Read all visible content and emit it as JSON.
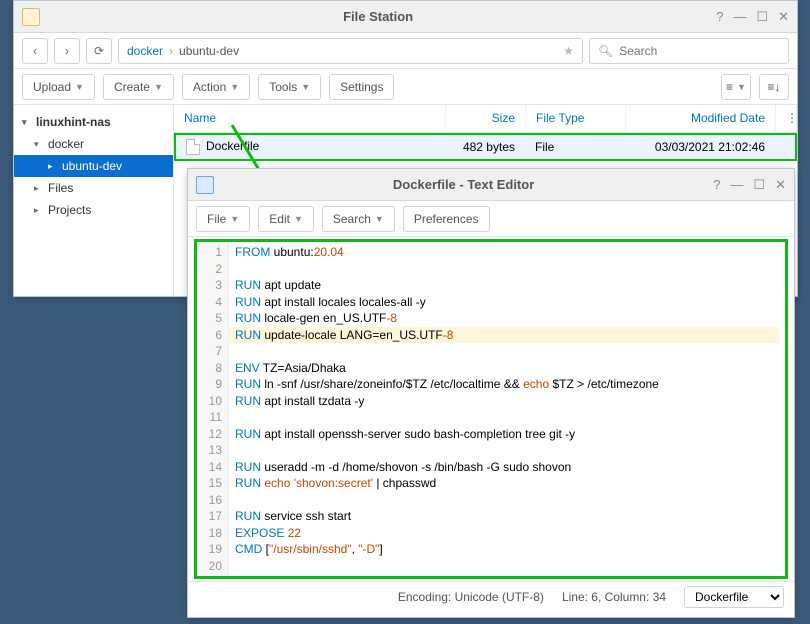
{
  "file_station": {
    "title": "File Station",
    "breadcrumb": [
      "docker",
      "ubuntu-dev"
    ],
    "search_placeholder": "Search",
    "toolbar": {
      "upload": "Upload",
      "create": "Create",
      "action": "Action",
      "tools": "Tools",
      "settings": "Settings"
    },
    "tree": {
      "root": "linuxhint-nas",
      "items": [
        {
          "label": "docker",
          "level": 1,
          "expanded": true
        },
        {
          "label": "ubuntu-dev",
          "level": 2,
          "selected": true
        },
        {
          "label": "Files",
          "level": 1
        },
        {
          "label": "Projects",
          "level": 1
        }
      ]
    },
    "columns": {
      "name": "Name",
      "size": "Size",
      "type": "File Type",
      "date": "Modified Date"
    },
    "rows": [
      {
        "name": "Dockerfile",
        "size": "482 bytes",
        "type": "File",
        "date": "03/03/2021 21:02:46"
      }
    ]
  },
  "text_editor": {
    "title": "Dockerfile - Text Editor",
    "toolbar": {
      "file": "File",
      "edit": "Edit",
      "search": "Search",
      "preferences": "Preferences"
    },
    "status": {
      "encoding": "Encoding: Unicode (UTF-8)",
      "cursor": "Line: 6, Column: 34",
      "lang": "Dockerfile"
    },
    "highlighted_line": 6,
    "lines": [
      {
        "n": 1,
        "tokens": [
          [
            "kw",
            "FROM"
          ],
          [
            "",
            " ubuntu:"
          ],
          [
            "num",
            "20.04"
          ]
        ]
      },
      {
        "n": 2,
        "tokens": []
      },
      {
        "n": 3,
        "tokens": [
          [
            "kw",
            "RUN"
          ],
          [
            "",
            " apt update"
          ]
        ]
      },
      {
        "n": 4,
        "tokens": [
          [
            "kw",
            "RUN"
          ],
          [
            "",
            " apt install locales locales-all -y"
          ]
        ]
      },
      {
        "n": 5,
        "tokens": [
          [
            "kw",
            "RUN"
          ],
          [
            "",
            " locale-gen en_US.UTF"
          ],
          [
            "num",
            "-8"
          ]
        ]
      },
      {
        "n": 6,
        "tokens": [
          [
            "kw",
            "RUN"
          ],
          [
            "",
            " update-locale LANG=en_US.UTF"
          ],
          [
            "num",
            "-8"
          ]
        ]
      },
      {
        "n": 7,
        "tokens": []
      },
      {
        "n": 8,
        "tokens": [
          [
            "kw",
            "ENV"
          ],
          [
            "",
            " TZ=Asia/Dhaka"
          ]
        ]
      },
      {
        "n": 9,
        "tokens": [
          [
            "kw",
            "RUN"
          ],
          [
            "",
            " ln -snf /usr/share/zoneinfo/$TZ /etc/localtime && "
          ],
          [
            "str",
            "echo"
          ],
          [
            "",
            " $TZ > /etc/timezone"
          ]
        ]
      },
      {
        "n": 10,
        "tokens": [
          [
            "kw",
            "RUN"
          ],
          [
            "",
            " apt install tzdata -y"
          ]
        ]
      },
      {
        "n": 11,
        "tokens": []
      },
      {
        "n": 12,
        "tokens": [
          [
            "kw",
            "RUN"
          ],
          [
            "",
            " apt install openssh-server sudo bash-completion tree git -y"
          ]
        ]
      },
      {
        "n": 13,
        "tokens": []
      },
      {
        "n": 14,
        "tokens": [
          [
            "kw",
            "RUN"
          ],
          [
            "",
            " useradd -m -d /home/shovon -s /bin/bash -G sudo shovon"
          ]
        ]
      },
      {
        "n": 15,
        "tokens": [
          [
            "kw",
            "RUN"
          ],
          [
            "",
            " "
          ],
          [
            "str",
            "echo"
          ],
          [
            "",
            " "
          ],
          [
            "str2",
            "'shovon:secret'"
          ],
          [
            "",
            " | chpasswd"
          ]
        ]
      },
      {
        "n": 16,
        "tokens": []
      },
      {
        "n": 17,
        "tokens": [
          [
            "kw",
            "RUN"
          ],
          [
            "",
            " service ssh start"
          ]
        ]
      },
      {
        "n": 18,
        "tokens": [
          [
            "kw",
            "EXPOSE"
          ],
          [
            "",
            " "
          ],
          [
            "num",
            "22"
          ]
        ]
      },
      {
        "n": 19,
        "tokens": [
          [
            "kw",
            "CMD"
          ],
          [
            "",
            " ["
          ],
          [
            "str2",
            "\"/usr/sbin/sshd\""
          ],
          [
            "",
            ", "
          ],
          [
            "str2",
            "\"-D\""
          ],
          [
            "",
            "]"
          ]
        ]
      },
      {
        "n": 20,
        "tokens": []
      }
    ]
  }
}
